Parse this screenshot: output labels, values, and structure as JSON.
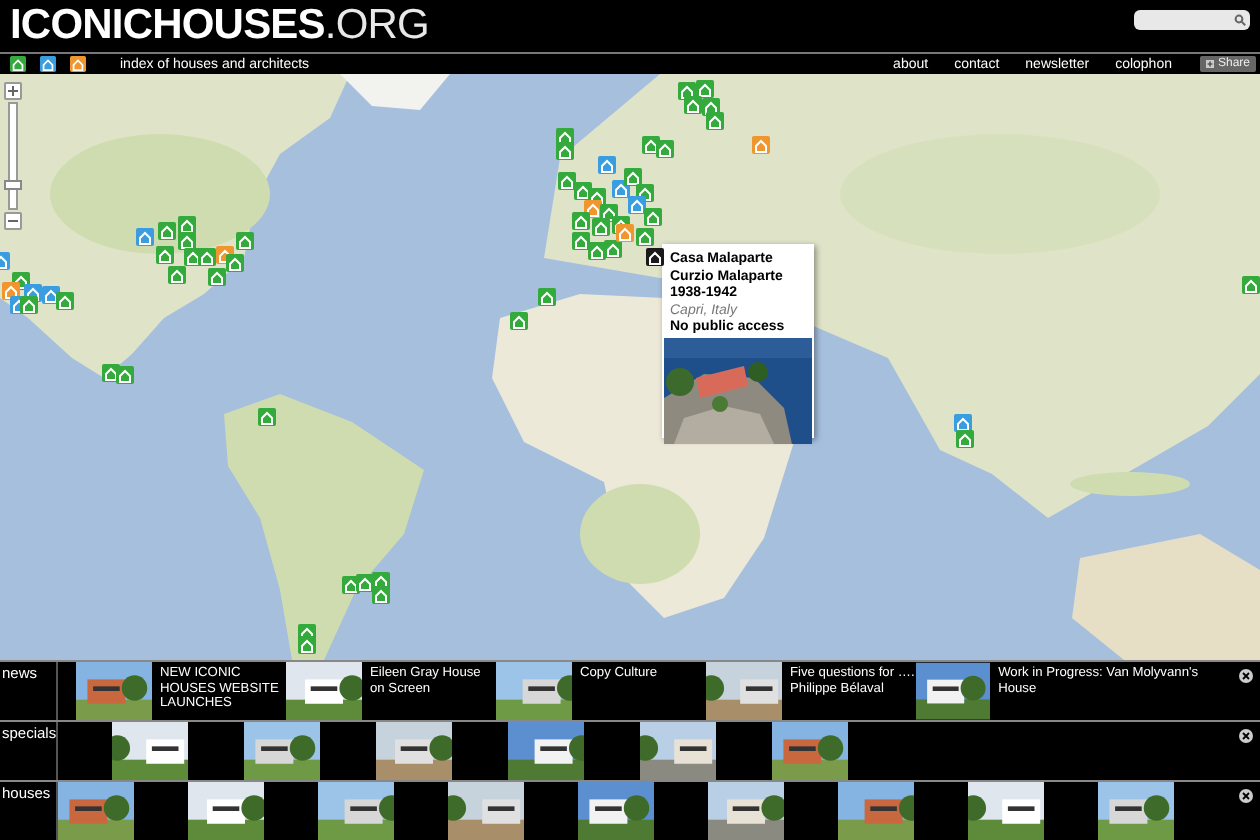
{
  "header": {
    "logo": "**ICONICHOUSES**.ORG"
  },
  "nav": {
    "legend": [
      {
        "color": "#34a93c"
      },
      {
        "color": "#3a9de0"
      },
      {
        "color": "#f0962e"
      }
    ],
    "tagline": "index of houses and architects",
    "links": [
      "about",
      "contact",
      "newsletter",
      "colophon"
    ],
    "share": "Share"
  },
  "map": {
    "zoom_slider": {
      "level": 0.2
    },
    "markers": [
      {
        "color": "#3a9de0"
      },
      {
        "color": "#34a93c"
      },
      {
        "color": "#34a93c"
      },
      {
        "color": "#34a93c"
      },
      {
        "color": "#34a93c"
      },
      {
        "color": "#34a93c"
      },
      {
        "color": "#34a93c"
      },
      {
        "color": "#34a93c"
      },
      {
        "color": "#34a93c"
      },
      {
        "color": "#34a93c"
      },
      {
        "color": "#f0962e"
      },
      {
        "color": "#34a93c"
      },
      {
        "color": "#3a9de0"
      },
      {
        "color": "#34a93c"
      },
      {
        "color": "#f0962e"
      },
      {
        "color": "#3a9de0"
      },
      {
        "color": "#3a9de0"
      },
      {
        "color": "#3a9de0"
      },
      {
        "color": "#34a93c"
      },
      {
        "color": "#34a93c"
      },
      {
        "color": "#34a93c"
      },
      {
        "color": "#34a93c"
      },
      {
        "color": "#34a93c"
      },
      {
        "color": "#34a93c"
      },
      {
        "color": "#34a93c"
      },
      {
        "color": "#34a93c"
      },
      {
        "color": "#34a93c"
      },
      {
        "color": "#34a93c"
      },
      {
        "color": "#34a93c"
      },
      {
        "color": "#34a93c"
      },
      {
        "color": "#34a93c"
      },
      {
        "color": "#3a9de0"
      },
      {
        "color": "#34a93c"
      },
      {
        "color": "#34a93c"
      },
      {
        "color": "#34a93c"
      },
      {
        "color": "#3a9de0"
      },
      {
        "color": "#34a93c"
      },
      {
        "color": "#34a93c"
      },
      {
        "color": "#3a9de0"
      },
      {
        "color": "#f0962e"
      },
      {
        "color": "#34a93c"
      },
      {
        "color": "#34a93c"
      },
      {
        "color": "#34a93c"
      },
      {
        "color": "#34a93c"
      },
      {
        "color": "#34a93c"
      },
      {
        "color": "#34a93c"
      },
      {
        "color": "#34a93c"
      },
      {
        "color": "#f0962e"
      },
      {
        "color": "#34a93c"
      },
      {
        "color": "#34a93c"
      },
      {
        "color": "#34a93c"
      },
      {
        "color": "#34a93c"
      },
      {
        "color": "#34a93c"
      },
      {
        "color": "#34a93c"
      },
      {
        "color": "#34a93c"
      },
      {
        "color": "#34a93c"
      },
      {
        "color": "#34a93c"
      },
      {
        "color": "#f0962e"
      },
      {
        "color": "#34a93c"
      },
      {
        "color": "#34a93c"
      },
      {
        "color": "#3a9de0"
      },
      {
        "color": "#34a93c"
      },
      {
        "color": "#34a93c"
      },
      {
        "color": "#1a1a1a"
      }
    ],
    "popup": {
      "lines": [
        {
          "kind": "bold",
          "text": "Casa Malaparte"
        },
        {
          "kind": "bold",
          "text": "Curzio Malaparte"
        },
        {
          "kind": "bold",
          "text": "1938-1942"
        },
        {
          "kind": "place",
          "text": "Capri, Italy"
        },
        {
          "kind": "bold",
          "text": "No public access"
        }
      ]
    }
  },
  "strips": [
    {
      "label": "news",
      "kind": "stories",
      "items": [
        {
          "kind": "story",
          "title": "NEW ICONIC HOUSES WEBSITE LAUNCHES"
        },
        {
          "kind": "story",
          "title": "Eileen Gray House on Screen"
        },
        {
          "kind": "story",
          "title": "Copy Culture"
        },
        {
          "kind": "story",
          "title": "Five questions for …. Philippe Bélaval"
        },
        {
          "kind": "story",
          "title": "Work in Progress: Van Molyvann's House"
        }
      ]
    },
    {
      "label": "specials",
      "kind": "gallery"
    },
    {
      "label": "houses",
      "kind": "row"
    }
  ]
}
